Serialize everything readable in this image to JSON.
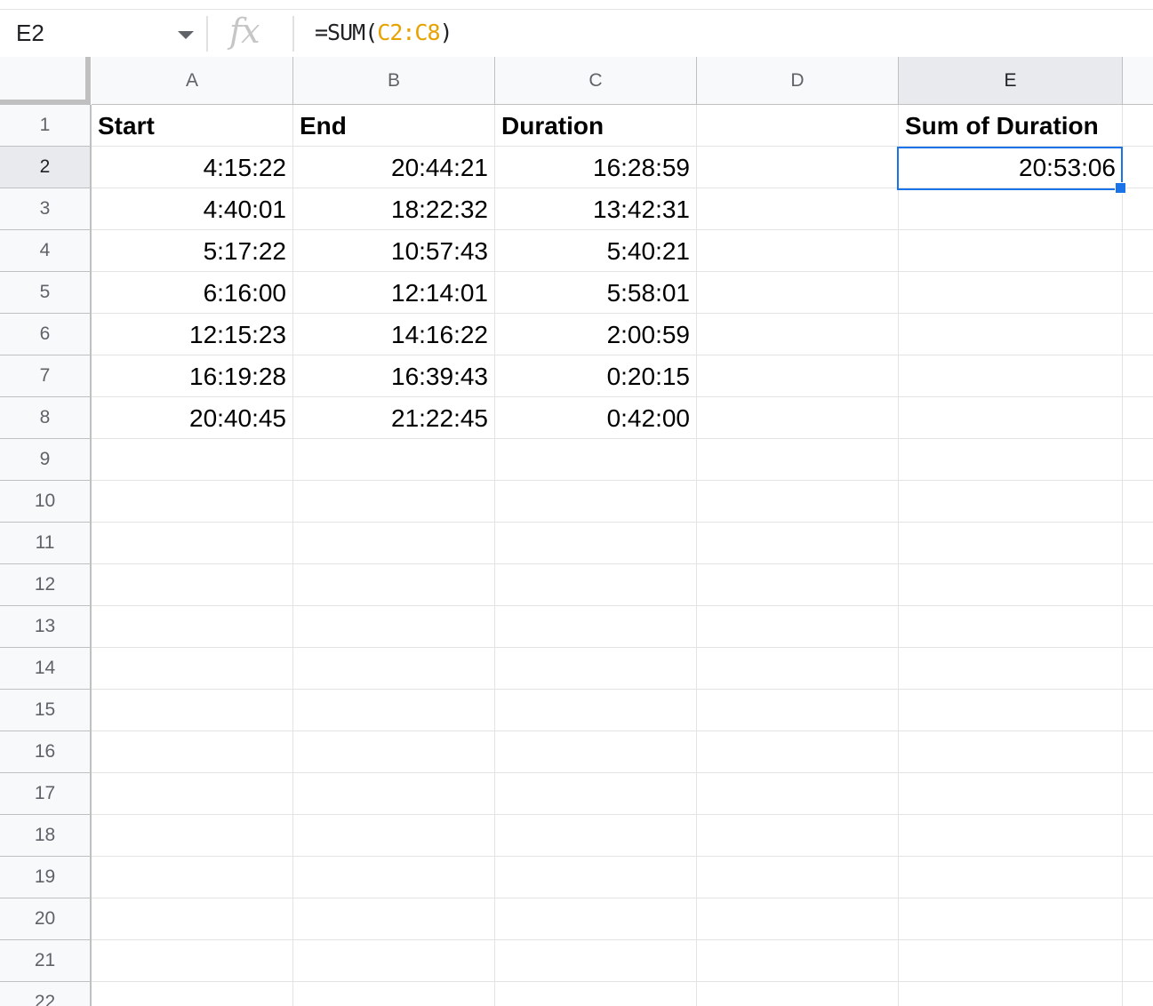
{
  "formula_bar": {
    "name_box": "E2",
    "fx_icon": "fx",
    "formula_prefix": "=SUM(",
    "formula_range": "C2:C8",
    "formula_suffix": ")",
    "range_color": "#e8a200"
  },
  "sheet": {
    "columns": [
      "A",
      "B",
      "C",
      "D",
      "E"
    ],
    "active_cell": "E2",
    "active_color": "#1a73e8",
    "rows": [
      {
        "n": "1",
        "A": "Start",
        "B": "End",
        "C": "Duration",
        "D": "",
        "E": "Sum of Duration"
      },
      {
        "n": "2",
        "A": "4:15:22",
        "B": "20:44:21",
        "C": "16:28:59",
        "D": "",
        "E": "20:53:06"
      },
      {
        "n": "3",
        "A": "4:40:01",
        "B": "18:22:32",
        "C": "13:42:31",
        "D": "",
        "E": ""
      },
      {
        "n": "4",
        "A": "5:17:22",
        "B": "10:57:43",
        "C": "5:40:21",
        "D": "",
        "E": ""
      },
      {
        "n": "5",
        "A": "6:16:00",
        "B": "12:14:01",
        "C": "5:58:01",
        "D": "",
        "E": ""
      },
      {
        "n": "6",
        "A": "12:15:23",
        "B": "14:16:22",
        "C": "2:00:59",
        "D": "",
        "E": ""
      },
      {
        "n": "7",
        "A": "16:19:28",
        "B": "16:39:43",
        "C": "0:20:15",
        "D": "",
        "E": ""
      },
      {
        "n": "8",
        "A": "20:40:45",
        "B": "21:22:45",
        "C": "0:42:00",
        "D": "",
        "E": ""
      },
      {
        "n": "9",
        "A": "",
        "B": "",
        "C": "",
        "D": "",
        "E": ""
      },
      {
        "n": "10",
        "A": "",
        "B": "",
        "C": "",
        "D": "",
        "E": ""
      },
      {
        "n": "11",
        "A": "",
        "B": "",
        "C": "",
        "D": "",
        "E": ""
      },
      {
        "n": "12",
        "A": "",
        "B": "",
        "C": "",
        "D": "",
        "E": ""
      },
      {
        "n": "13",
        "A": "",
        "B": "",
        "C": "",
        "D": "",
        "E": ""
      },
      {
        "n": "14",
        "A": "",
        "B": "",
        "C": "",
        "D": "",
        "E": ""
      },
      {
        "n": "15",
        "A": "",
        "B": "",
        "C": "",
        "D": "",
        "E": ""
      },
      {
        "n": "16",
        "A": "",
        "B": "",
        "C": "",
        "D": "",
        "E": ""
      },
      {
        "n": "17",
        "A": "",
        "B": "",
        "C": "",
        "D": "",
        "E": ""
      },
      {
        "n": "18",
        "A": "",
        "B": "",
        "C": "",
        "D": "",
        "E": ""
      },
      {
        "n": "19",
        "A": "",
        "B": "",
        "C": "",
        "D": "",
        "E": ""
      },
      {
        "n": "20",
        "A": "",
        "B": "",
        "C": "",
        "D": "",
        "E": ""
      },
      {
        "n": "21",
        "A": "",
        "B": "",
        "C": "",
        "D": "",
        "E": ""
      },
      {
        "n": "22",
        "A": "",
        "B": "",
        "C": "",
        "D": "",
        "E": ""
      }
    ]
  }
}
